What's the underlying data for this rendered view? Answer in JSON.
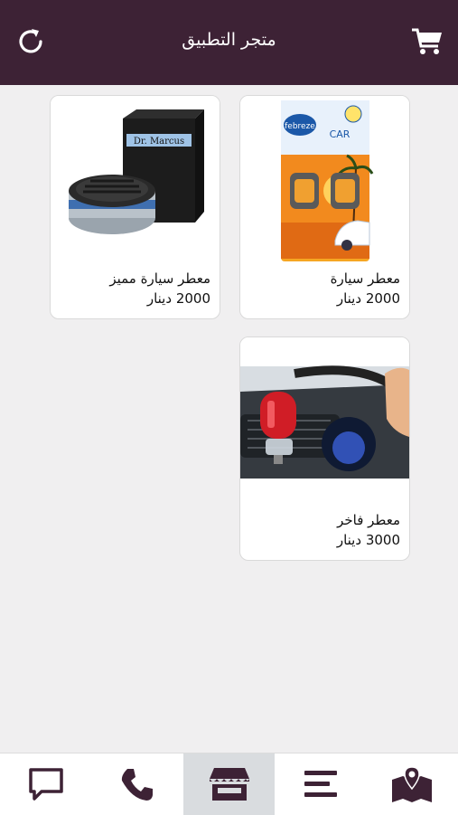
{
  "header": {
    "title": "متجر التطبيق",
    "left_icon": "refresh-icon",
    "right_icon": "cart-icon"
  },
  "products": [
    {
      "name": "معطر سيارة",
      "price": "2000 دينار"
    },
    {
      "name": "معطر سيارة مميز",
      "price": "2000 دينار"
    },
    {
      "name": "معطر فاخر",
      "price": "3000 دينار"
    }
  ],
  "bottom_nav": {
    "items": [
      "chat-icon",
      "phone-icon",
      "store-icon",
      "menu-icon",
      "map-icon"
    ],
    "active": "store-icon"
  },
  "colors": {
    "header_bg": "#3d2235",
    "icon": "#3d2235",
    "background": "#f0eff0",
    "active_tab": "#d9dcdf"
  },
  "product_images": {
    "first": {
      "brand_text": "febreze",
      "label": "CAR"
    },
    "second": {
      "brand_text": "Dr. Marcus"
    }
  }
}
